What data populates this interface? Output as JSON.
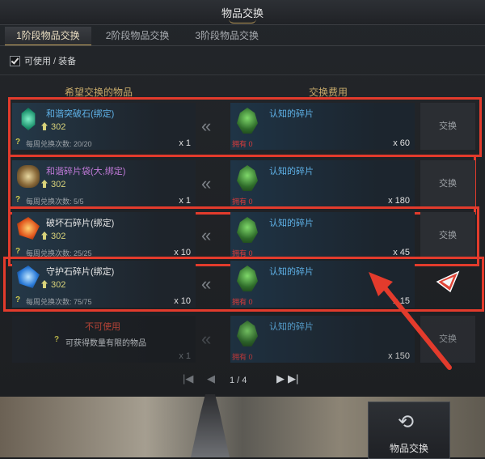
{
  "window": {
    "title": "物品交换"
  },
  "tabs": [
    {
      "label": "1阶段物品交换"
    },
    {
      "label": "2阶段物品交换"
    },
    {
      "label": "3阶段物品交换"
    }
  ],
  "filter": {
    "label": "可使用 / 装备",
    "checked": true
  },
  "columns": {
    "wanted": "希望交换的物品",
    "cost": "交换费用"
  },
  "rows": [
    {
      "name": "和谐突破石(绑定)",
      "level": "302",
      "weekly": "每周兑换次数: 20/20",
      "qty": "x 1",
      "cost_name": "认知的碎片",
      "owned": "拥有 0",
      "cost_qty": "x 60",
      "button": "交换"
    },
    {
      "name": "和谐碎片袋(大,绑定)",
      "level": "302",
      "weekly": "每周兑换次数: 5/5",
      "qty": "x 1",
      "cost_name": "认知的碎片",
      "owned": "拥有 0",
      "cost_qty": "x 180",
      "button": "交换"
    },
    {
      "name": "破坏石碎片(绑定)",
      "level": "302",
      "weekly": "每周兑换次数: 25/25",
      "qty": "x 10",
      "cost_name": "认知的碎片",
      "owned": "拥有 0",
      "cost_qty": "x 45",
      "button": "交换"
    },
    {
      "name": "守护石碎片(绑定)",
      "level": "302",
      "weekly": "每周兑换次数: 75/75",
      "qty": "x 10",
      "cost_name": "认知的碎片",
      "owned": "拥有 0",
      "cost_qty": "x 15",
      "button": ""
    },
    {
      "status": "不可使用",
      "note": "可获得数量有限的物品",
      "qty": "x 1",
      "cost_name": "认知的碎片",
      "owned": "拥有 0",
      "cost_qty": "x 150",
      "button": "交换"
    }
  ],
  "pager": {
    "text": "1 / 4"
  },
  "exchange_button": {
    "label": "物品交换"
  },
  "colors": {
    "accent": "#c7a96a",
    "highlight": "#e33b2c",
    "cost_name": "#5fb2e8",
    "owned": "#d63c3c",
    "level": "#d8d27a"
  }
}
